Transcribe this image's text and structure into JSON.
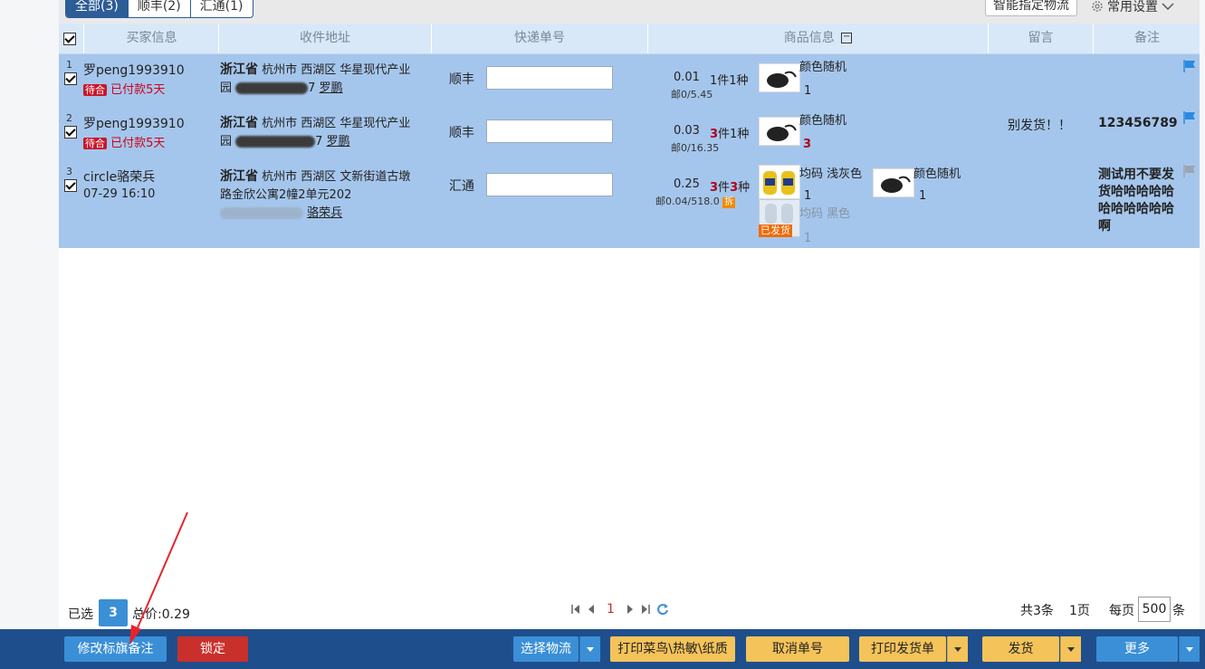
{
  "tabs": [
    {
      "label": "全部(3)",
      "active": true
    },
    {
      "label": "顺丰(2)",
      "active": false
    },
    {
      "label": "汇通(1)",
      "active": false
    }
  ],
  "toolbar": {
    "smart_logistics": "智能指定物流",
    "common_settings": "常用设置"
  },
  "columns": {
    "buyer": "买家信息",
    "address": "收件地址",
    "tracking": "快递单号",
    "goods": "商品信息",
    "message": "留言",
    "remark": "备注"
  },
  "orders": [
    {
      "num": "1",
      "buyer": "罗peng1993910",
      "tag": "待合",
      "status": "已付款5天",
      "province": "浙江省",
      "addr1": "杭州市 西湖区 华星现代产业",
      "addr2_prefix": "园",
      "addr2_mid": "7",
      "receiver": "罗鹏",
      "carrier": "顺丰",
      "price": "0.01",
      "count": "1件1种",
      "shipping": "邮0/5.45",
      "item_name": "颜色随机",
      "qty": "1",
      "message": "",
      "remark": "",
      "flag_color": "#2a8ae0"
    },
    {
      "num": "2",
      "buyer": "罗peng1993910",
      "tag": "待合",
      "status": "已付款5天",
      "province": "浙江省",
      "addr1": "杭州市 西湖区 华星现代产业",
      "addr2_prefix": "园",
      "addr2_mid": "7",
      "receiver": "罗鹏",
      "carrier": "顺丰",
      "price": "0.03",
      "count_num": "3",
      "count_rest": "件1种",
      "shipping": "邮0/16.35",
      "item_name": "颜色随机",
      "qty": "3",
      "message": "别发货！！",
      "remark": "123456789",
      "flag_color": "#2a8ae0"
    },
    {
      "num": "3",
      "buyer": "circle骆荣兵",
      "time": "07-29 16:10",
      "province": "浙江省",
      "addr1": "杭州市 西湖区 文新街道古墩",
      "addr2": "路金欣公寓2幢2单元202",
      "receiver": "骆荣兵",
      "carrier": "汇通",
      "price": "0.25",
      "count_num1": "3",
      "count_mid": "件",
      "count_num2": "3",
      "count_rest": "种",
      "shipping": "邮0.04/518.0",
      "split": "拆",
      "item1_name": "均码 浅灰色",
      "item1_qty": "1",
      "item2_name": "颜色随机",
      "item2_qty": "1",
      "item3_name": "均码 黑色",
      "item3_qty": "1",
      "item3_badge": "已发货",
      "remark": "测试用不要发货哈哈哈哈哈哈哈哈哈哈哈啊",
      "flag_color": "#9aa5b1"
    }
  ],
  "footer": {
    "selected_label": "已选",
    "selected_count": "3",
    "total_label": "总价:0.29",
    "page_current": "1",
    "total_records": "共3条",
    "total_pages": "1页",
    "per_page_label": "每页",
    "per_page_value": "500",
    "per_page_unit": "条"
  },
  "actions": {
    "edit_flag": "修改标旗备注",
    "lock": "锁定",
    "choose_logistics": "选择物流",
    "print_waybill": "打印菜鸟\\热敏\\纸质",
    "cancel_number": "取消单号",
    "print_invoice": "打印发货单",
    "ship": "发货",
    "more": "更多"
  },
  "colors": {
    "header_bg": "#d8e8f8",
    "row_bg": "#a5c6ec",
    "action_bar": "#1f4e8c",
    "accent_blue": "#3a8fd6",
    "warning_yellow": "#f4c35a",
    "danger_red": "#c9302c"
  }
}
